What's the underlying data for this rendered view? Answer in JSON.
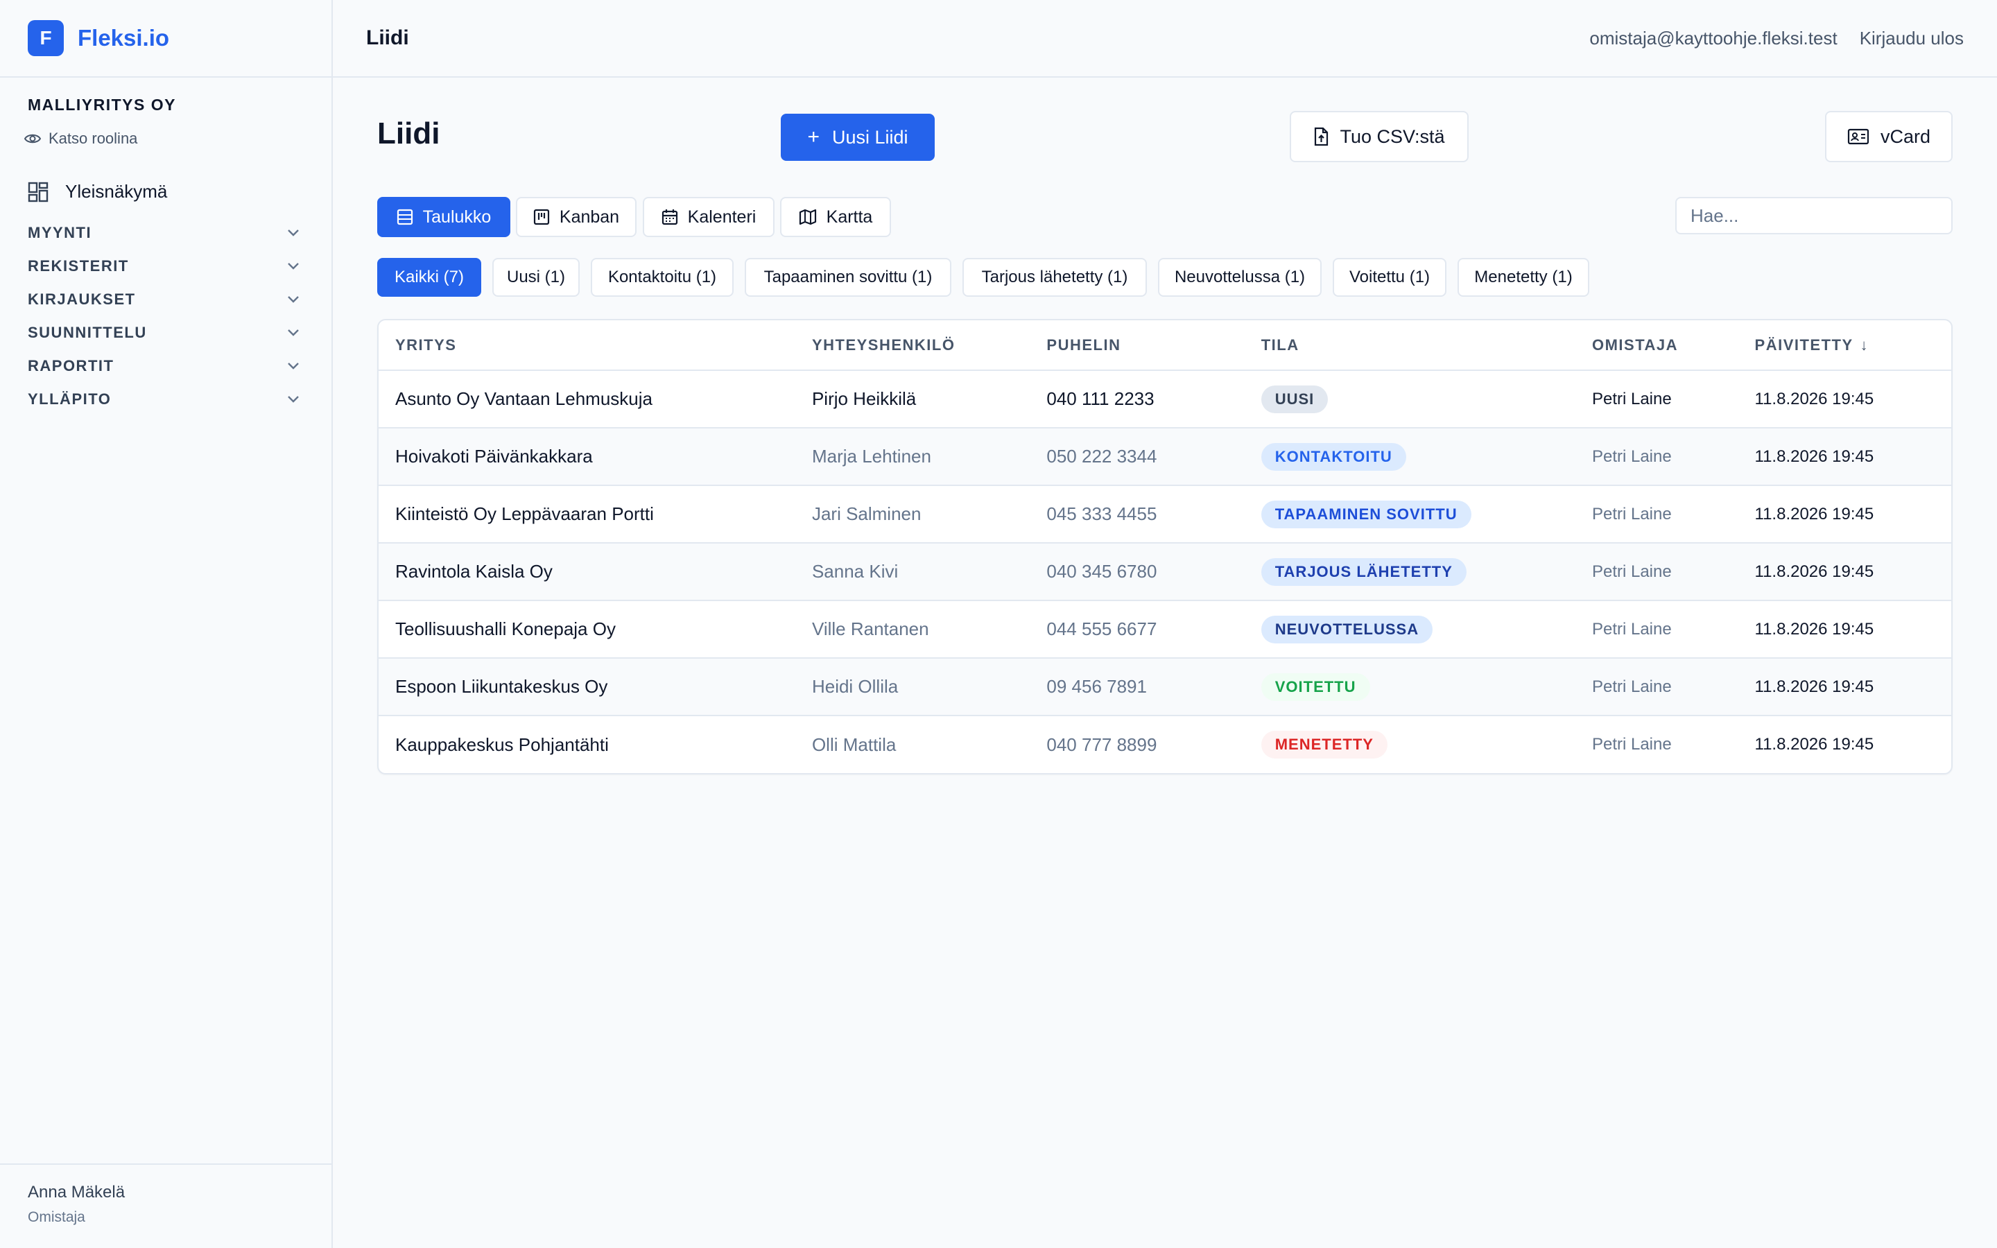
{
  "brand": {
    "logo_letter": "F",
    "name": "Fleksi.io"
  },
  "sidebar": {
    "company": "MALLIYRITYS OY",
    "view_role": "Katso roolina",
    "overview": "Yleisnäkymä",
    "groups": [
      {
        "label": "MYYNTI"
      },
      {
        "label": "REKISTERIT"
      },
      {
        "label": "KIRJAUKSET"
      },
      {
        "label": "SUUNNITTELU"
      },
      {
        "label": "RAPORTIT"
      },
      {
        "label": "YLLÄPITO"
      }
    ],
    "user": {
      "name": "Anna Mäkelä",
      "role": "Omistaja"
    }
  },
  "header": {
    "title": "Liidi",
    "email": "omistaja@kayttoohje.fleksi.test",
    "logout": "Kirjaudu ulos"
  },
  "page": {
    "title": "Liidi",
    "new_button": "Uusi Liidi",
    "csv_button": "Tuo CSV:stä",
    "vcard_button": "vCard"
  },
  "view_tabs": [
    {
      "label": "Taulukko",
      "icon": "table-icon",
      "active": true
    },
    {
      "label": "Kanban",
      "icon": "kanban-icon",
      "active": false
    },
    {
      "label": "Kalenteri",
      "icon": "calendar-icon",
      "active": false
    },
    {
      "label": "Kartta",
      "icon": "map-icon",
      "active": false
    }
  ],
  "search": {
    "placeholder": "Hae..."
  },
  "filters": [
    {
      "label": "Kaikki (7)",
      "active": true
    },
    {
      "label": "Uusi (1)",
      "active": false
    },
    {
      "label": "Kontaktoitu (1)",
      "active": false
    },
    {
      "label": "Tapaaminen sovittu (1)",
      "active": false
    },
    {
      "label": "Tarjous lähetetty (1)",
      "active": false
    },
    {
      "label": "Neuvottelussa (1)",
      "active": false
    },
    {
      "label": "Voitettu (1)",
      "active": false
    },
    {
      "label": "Menetetty (1)",
      "active": false
    }
  ],
  "table": {
    "columns": [
      "YRITYS",
      "YHTEYSHENKILÖ",
      "PUHELIN",
      "TILA",
      "OMISTAJA",
      "PÄIVITETTY"
    ],
    "sort_indicator": "↓",
    "rows": [
      {
        "company": "Asunto Oy Vantaan Lehmuskuja",
        "contact": "Pirjo Heikkilä",
        "phone": "040 111 2233",
        "status": "UUSI",
        "status_bg": "#e2e8f0",
        "status_fg": "#334155",
        "owner": "Petri Laine",
        "updated": "11.8.2026 19:45"
      },
      {
        "company": "Hoivakoti Päivänkakkara",
        "contact": "Marja Lehtinen",
        "phone": "050 222 3344",
        "status": "KONTAKTOITU",
        "status_bg": "#dbeafe",
        "status_fg": "#2563eb",
        "owner": "Petri Laine",
        "updated": "11.8.2026 19:45"
      },
      {
        "company": "Kiinteistö Oy Leppävaaran Portti",
        "contact": "Jari Salminen",
        "phone": "045 333 4455",
        "status": "TAPAAMINEN SOVITTU",
        "status_bg": "#dbeafe",
        "status_fg": "#1d4ed8",
        "owner": "Petri Laine",
        "updated": "11.8.2026 19:45"
      },
      {
        "company": "Ravintola Kaisla Oy",
        "contact": "Sanna Kivi",
        "phone": "040 345 6780",
        "status": "TARJOUS LÄHETETTY",
        "status_bg": "#dbeafe",
        "status_fg": "#1e40af",
        "owner": "Petri Laine",
        "updated": "11.8.2026 19:45"
      },
      {
        "company": "Teollisuushalli Konepaja Oy",
        "contact": "Ville Rantanen",
        "phone": "044 555 6677",
        "status": "NEUVOTTELUSSA",
        "status_bg": "#dbeafe",
        "status_fg": "#1e3a8a",
        "owner": "Petri Laine",
        "updated": "11.8.2026 19:45"
      },
      {
        "company": "Espoon Liikuntakeskus Oy",
        "contact": "Heidi Ollila",
        "phone": "09 456 7891",
        "status": "VOITETTU",
        "status_bg": "#f0fdf4",
        "status_fg": "#16a34a",
        "owner": "Petri Laine",
        "updated": "11.8.2026 19:45"
      },
      {
        "company": "Kauppakeskus Pohjantähti",
        "contact": "Olli Mattila",
        "phone": "040 777 8899",
        "status": "MENETETTY",
        "status_bg": "#fef2f2",
        "status_fg": "#dc2626",
        "owner": "Petri Laine",
        "updated": "11.8.2026 19:45"
      }
    ]
  },
  "colors": {
    "accent": "#2563eb",
    "border": "#e2e8f0",
    "background": "#f8fafc"
  }
}
